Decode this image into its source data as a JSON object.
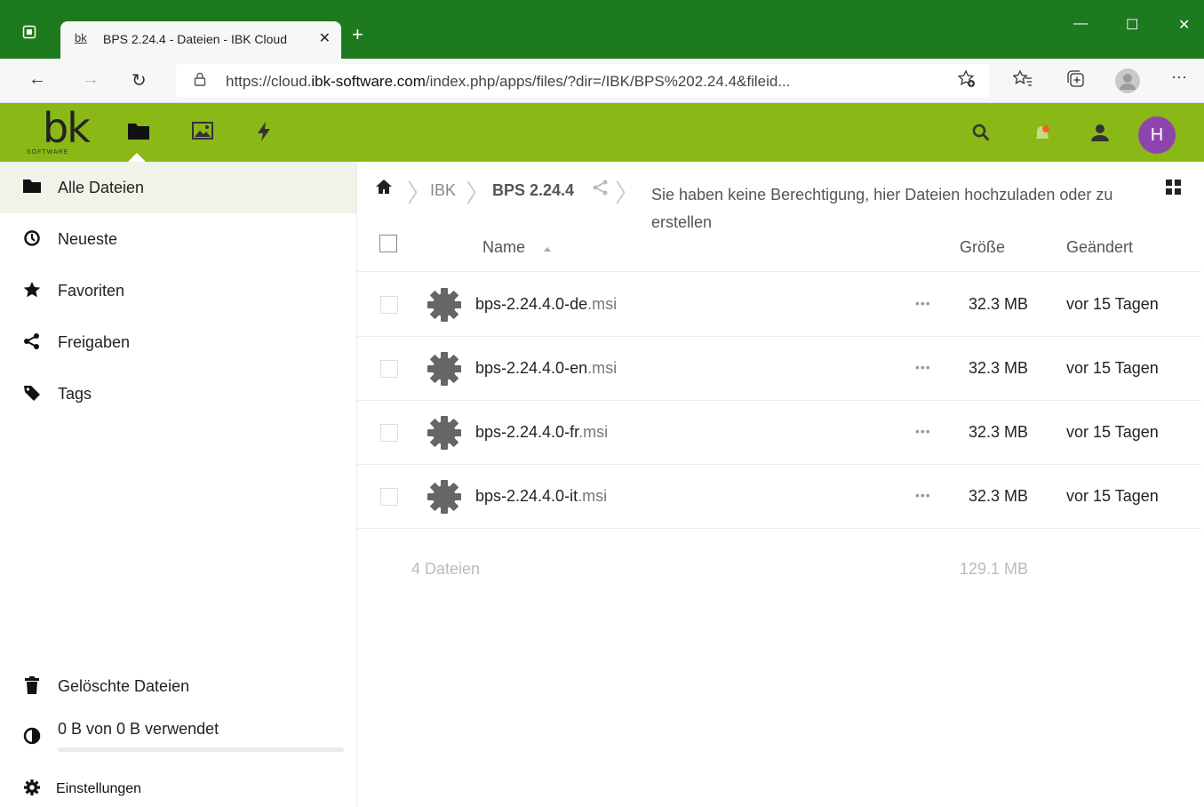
{
  "browser": {
    "tab_favicon": "bk",
    "tab_title": "BPS 2.24.4 - Dateien - IBK Cloud",
    "tab_close": "✕",
    "new_tab": "+",
    "window_minimize": "—",
    "window_maximize": "☐",
    "window_close": "✕",
    "back": "←",
    "forward": "→",
    "reload": "↻",
    "url_prefix": "https://cloud.",
    "url_domain": "ibk-software.com",
    "url_rest": "/index.php/apps/files/?dir=/IBK/BPS%202.24.4&fileid...",
    "more_menu": "···"
  },
  "header": {
    "logo_text": "bk",
    "logo_subtext": "SOFTWARE",
    "avatar_initial": "H",
    "colors": {
      "header_bg": "#8ab817",
      "avatar_bg": "#8e44ad"
    }
  },
  "sidebar": {
    "items": [
      {
        "label": "Alle Dateien",
        "icon": "folder-icon",
        "active": true
      },
      {
        "label": "Neueste",
        "icon": "clock-icon"
      },
      {
        "label": "Favoriten",
        "icon": "star-icon"
      },
      {
        "label": "Freigaben",
        "icon": "share-icon"
      },
      {
        "label": "Tags",
        "icon": "tag-icon"
      }
    ],
    "deleted_label": "Gelöschte Dateien",
    "quota_label": "0 B von 0 B verwendet",
    "settings_label": "Einstellungen"
  },
  "breadcrumb": {
    "items": [
      "IBK",
      "BPS 2.24.4"
    ]
  },
  "permission_message": "Sie haben keine Berechtigung, hier Dateien hochzuladen oder zu erstellen",
  "table": {
    "headers": {
      "name": "Name",
      "size": "Größe",
      "modified": "Geändert"
    },
    "rows": [
      {
        "base": "bps-2.24.4.0-de",
        "ext": ".msi",
        "size": "32.3 MB",
        "modified": "vor 15 Tagen"
      },
      {
        "base": "bps-2.24.4.0-en",
        "ext": ".msi",
        "size": "32.3 MB",
        "modified": "vor 15 Tagen"
      },
      {
        "base": "bps-2.24.4.0-fr",
        "ext": ".msi",
        "size": "32.3 MB",
        "modified": "vor 15 Tagen"
      },
      {
        "base": "bps-2.24.4.0-it",
        "ext": ".msi",
        "size": "32.3 MB",
        "modified": "vor 15 Tagen"
      }
    ],
    "row_actions": "•••",
    "summary_count": "4 Dateien",
    "summary_size": "129.1 MB"
  }
}
